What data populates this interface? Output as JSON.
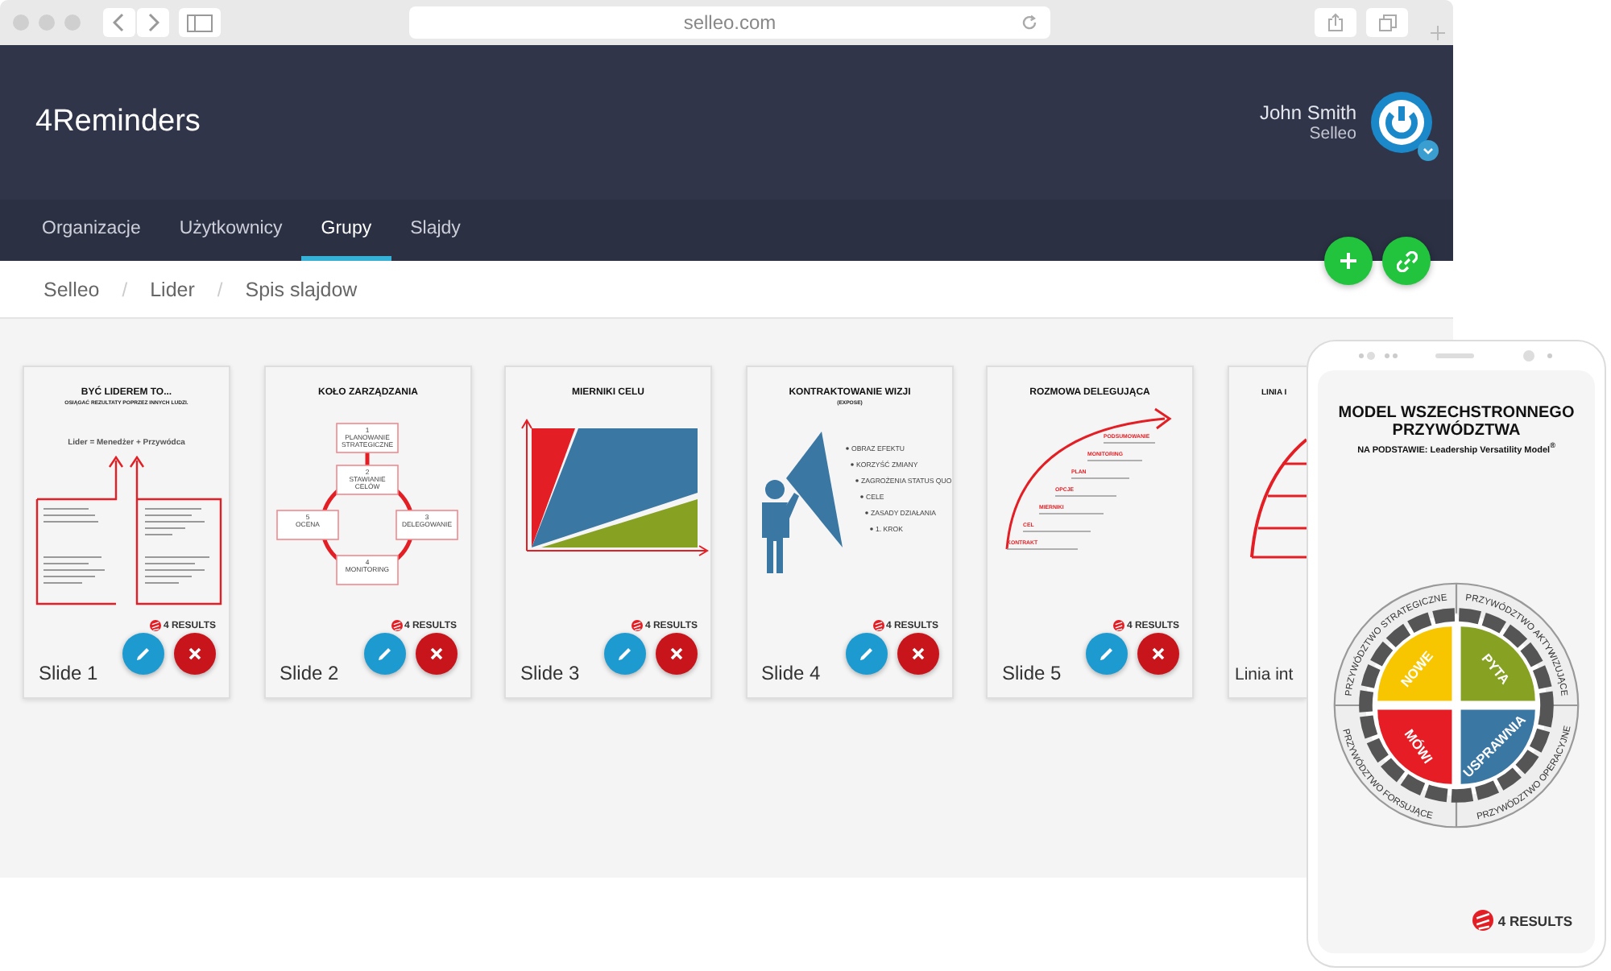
{
  "browser": {
    "address": "selleo.com"
  },
  "app": {
    "title": "4Reminders",
    "user": {
      "name": "John Smith",
      "company": "Selleo"
    }
  },
  "tabs": [
    {
      "label": "Organizacje",
      "selected": false
    },
    {
      "label": "Użytkownicy",
      "selected": false
    },
    {
      "label": "Grupy",
      "selected": true
    },
    {
      "label": "Slajdy",
      "selected": false
    }
  ],
  "breadcrumb": {
    "separator": "/",
    "items": [
      "Selleo",
      "Lider",
      "Spis slajdow"
    ]
  },
  "slides": [
    {
      "kind": "leader",
      "label": "Slide 1",
      "logo": "4 RESULTS",
      "title": "BYĆ LIDEREM TO...",
      "subtitle": "OSIĄGAĆ REZULTATY POPRZEZ INNYCH LUDZI.",
      "equation": "Lider = Menedżer + Przywódca"
    },
    {
      "kind": "cycle",
      "label": "Slide 2",
      "logo": "4 RESULTS",
      "title": "KOŁO ZARZĄDZANIA",
      "steps": [
        {
          "number": "1",
          "label": "PLANOWANIE STRATEGICZNE"
        },
        {
          "number": "2",
          "label": "STAWIANIE CELÓW"
        },
        {
          "number": "3",
          "label": "DELEGOWANIE"
        },
        {
          "number": "4",
          "label": "MONITORING"
        },
        {
          "number": "5",
          "label": "OCENA"
        }
      ]
    },
    {
      "kind": "area",
      "label": "Slide 3",
      "logo": "4 RESULTS",
      "title": "MIERNIKI CELU"
    },
    {
      "kind": "vision",
      "label": "Slide 4",
      "logo": "4 RESULTS",
      "title": "KONTRAKTOWANIE WIZJI",
      "subtitle": "(EXPOSE)",
      "bullets": [
        "OBRAZ EFEKTU",
        "KORZYŚĆ ZMIANY",
        "ZAGROŻENIA STATUS QUO",
        "CELE",
        "ZASADY DZIAŁANIA",
        "1. KROK"
      ]
    },
    {
      "kind": "arc",
      "label": "Slide 5",
      "logo": "4 RESULTS",
      "title": "ROZMOWA DELEGUJĄCA",
      "steps": [
        "PODSUMOWANIE",
        "MONITORING",
        "PLAN",
        "OPCJE",
        "MIERNIKI",
        "CEL",
        "KONTRAKT"
      ]
    },
    {
      "kind": "timeline",
      "label": "Linia int",
      "title": "LINIA I"
    }
  ],
  "phone": {
    "title": "MODEL WSZECHSTRONNEGO PRZYWÓDZTWA",
    "subtitle": "NA PODSTAWIE: Leadership Versatility Model$^{®}$",
    "quadrants": [
      {
        "label": "NOWE",
        "color": "#f7c600"
      },
      {
        "label": "PYTA",
        "color": "#87a122"
      },
      {
        "label": "MÓWI",
        "color": "#e61d25"
      },
      {
        "label": "USPRAWNIA",
        "color": "#3a77a3"
      }
    ],
    "ring": [
      "PRZYWÓDZTWO STRATEGICZNE",
      "PRZYWÓDZTWO AKTYWIZUJĄCE",
      "PRZYWÓDZTWO FORSUJĄCE",
      "PRZYWÓDZTWO OPERACYJNE"
    ],
    "logo": "4 RESULTS"
  }
}
